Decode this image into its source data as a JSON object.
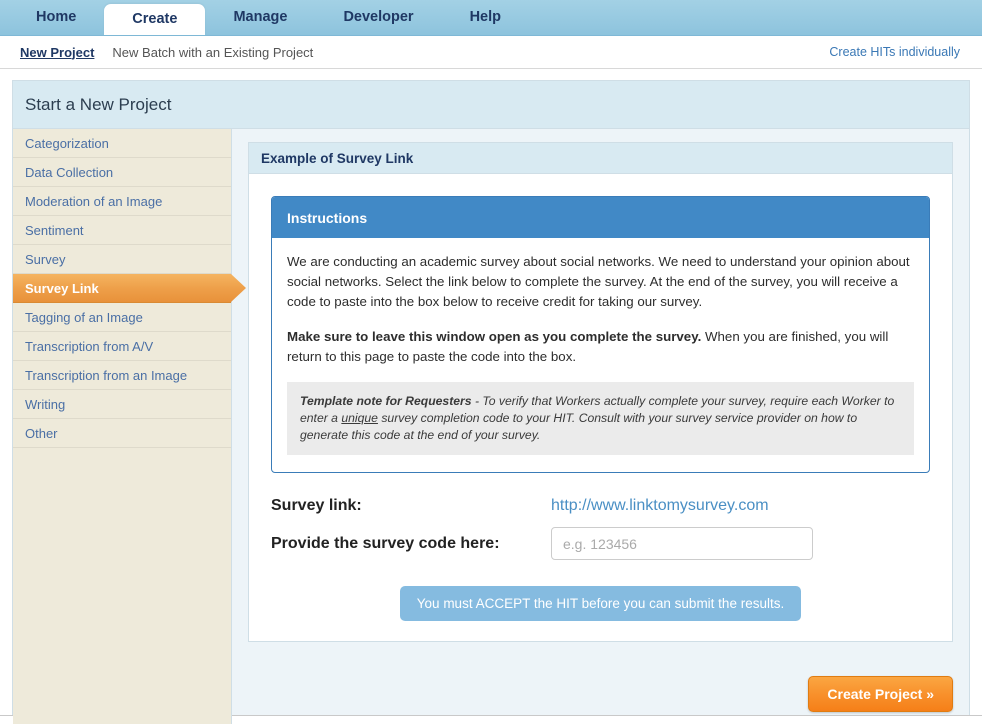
{
  "tabs": [
    {
      "label": "Home",
      "active": false
    },
    {
      "label": "Create",
      "active": true
    },
    {
      "label": "Manage",
      "active": false
    },
    {
      "label": "Developer",
      "active": false
    },
    {
      "label": "Help",
      "active": false
    }
  ],
  "subnav": {
    "new_project": "New Project",
    "new_batch": "New Batch with an Existing Project",
    "create_hits": "Create HITs individually"
  },
  "page": {
    "title": "Start a New Project"
  },
  "sidebar": {
    "items": [
      {
        "label": "Categorization",
        "active": false
      },
      {
        "label": "Data Collection",
        "active": false
      },
      {
        "label": "Moderation of an Image",
        "active": false
      },
      {
        "label": "Sentiment",
        "active": false
      },
      {
        "label": "Survey",
        "active": false
      },
      {
        "label": "Survey Link",
        "active": true
      },
      {
        "label": "Tagging of an Image",
        "active": false
      },
      {
        "label": "Transcription from A/V",
        "active": false
      },
      {
        "label": "Transcription from an Image",
        "active": false
      },
      {
        "label": "Writing",
        "active": false
      },
      {
        "label": "Other",
        "active": false
      }
    ]
  },
  "main": {
    "card_title": "Example of Survey Link",
    "instructions": {
      "heading": "Instructions",
      "paragraph1": "We are conducting an academic survey about social networks. We need to understand your opinion about social networks. Select the link below to complete the survey. At the end of the survey, you will receive a code to paste into the box below to receive credit for taking our survey.",
      "paragraph2_bold": "Make sure to leave this window open as you complete the survey.",
      "paragraph2_rest": " When you are finished, you will return to this page to paste the code into the box.",
      "note_bold": "Template note for Requesters",
      "note_part1": " - To verify that Workers actually complete your survey, require each Worker to enter a ",
      "note_underline": "unique",
      "note_part2": " survey completion code to your HIT. Consult with your survey service provider on how to generate this code at the end of your survey."
    },
    "survey_link_label": "Survey link:",
    "survey_link_url": "http://www.linktomysurvey.com",
    "survey_code_label": "Provide the survey code here:",
    "survey_code_value": "",
    "survey_code_placeholder": "e.g. 123456",
    "submit_disabled_label": "You must ACCEPT the HIT before you can submit the results."
  },
  "footer": {
    "create_project_label": "Create Project »"
  },
  "colors": {
    "tabbar": "#95c8e0",
    "accent_orange": "#f8912c",
    "active_sidebar_orange": "#eea04a",
    "instructions_blue": "#4189c6",
    "panel_header_blue": "#d8eaf2",
    "sidebar_beige": "#eeeada",
    "link_blue": "#4a8fc4",
    "disabled_blue": "#85bbe0"
  }
}
